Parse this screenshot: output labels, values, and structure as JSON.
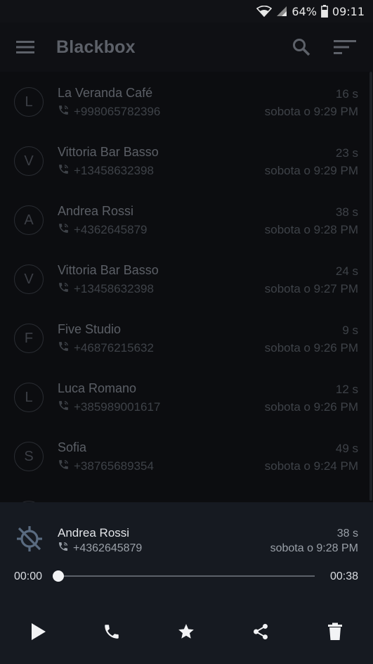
{
  "status_bar": {
    "battery": "64%",
    "time": "09:11"
  },
  "app_bar": {
    "title": "Blackbox"
  },
  "icons": {
    "menu": "menu-icon",
    "search": "search-icon",
    "sort": "sort-icon",
    "call": "phone-call-icon",
    "gps_off": "location-off-icon",
    "play": "play-icon",
    "phone": "phone-icon",
    "star": "star-icon",
    "share": "share-icon",
    "delete": "trash-icon"
  },
  "calls": [
    {
      "initial": "L",
      "name": "La Veranda Café",
      "number": "+998065782396",
      "duration": "16 s",
      "date": "sobota o 9:29 PM"
    },
    {
      "initial": "V",
      "name": "Vittoria Bar Basso",
      "number": "+13458632398",
      "duration": "23 s",
      "date": "sobota o 9:29 PM"
    },
    {
      "initial": "A",
      "name": "Andrea Rossi",
      "number": "+4362645879",
      "duration": "38 s",
      "date": "sobota o 9:28 PM"
    },
    {
      "initial": "V",
      "name": "Vittoria Bar Basso",
      "number": "+13458632398",
      "duration": "24 s",
      "date": "sobota o 9:27 PM"
    },
    {
      "initial": "F",
      "name": "Five Studio",
      "number": "+46876215632",
      "duration": "9 s",
      "date": "sobota o 9:26 PM"
    },
    {
      "initial": "L",
      "name": "Luca Romano",
      "number": "+385989001617",
      "duration": "12 s",
      "date": "sobota o 9:26 PM"
    },
    {
      "initial": "S",
      "name": "Sofia",
      "number": "+38765689354",
      "duration": "49 s",
      "date": "sobota o 9:24 PM"
    }
  ],
  "player": {
    "name": "Andrea Rossi",
    "number": "+4362645879",
    "duration": "38 s",
    "date": "sobota o 9:28 PM",
    "position": "00:00",
    "length": "00:38",
    "progress": 0
  },
  "colors": {
    "background": "#0c0d10",
    "player_bg": "#161a21",
    "accent_icon": "#5a6b80"
  }
}
